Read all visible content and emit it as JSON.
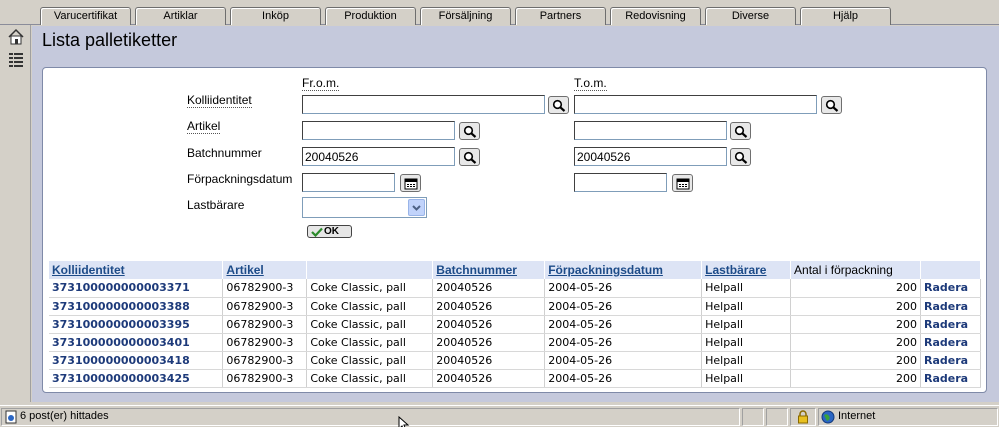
{
  "menu": {
    "tabs": [
      "Varucertifikat",
      "Artiklar",
      "Inköp",
      "Produktion",
      "Försäljning",
      "Partners",
      "Redovisning",
      "Diverse",
      "Hjälp"
    ]
  },
  "page": {
    "title": "Lista palletiketter"
  },
  "form": {
    "from_header": "Fr.o.m.",
    "to_header": "T.o.m.",
    "fields": {
      "kolli_label": "Kolliidentitet",
      "kolli_from": "",
      "kolli_to": "",
      "artikel_label": "Artikel",
      "artikel_from": "",
      "artikel_to": "",
      "batch_label": "Batchnummer",
      "batch_from": "20040526",
      "batch_to": "20040526",
      "forp_label": "Förpackningsdatum",
      "forp_from": "",
      "forp_to": "",
      "last_label": "Lastbärare",
      "last_value": ""
    },
    "ok_label": "OK"
  },
  "table": {
    "headers": [
      "Kolliidentitet",
      "Artikel",
      "",
      "Batchnummer",
      "Förpackningsdatum",
      "Lastbärare",
      "Antal i förpackning",
      ""
    ],
    "rows": [
      [
        "373100000000003371",
        "06782900-3",
        "Coke Classic, pall",
        "20040526",
        "2004-05-26",
        "Helpall",
        "200",
        "Radera"
      ],
      [
        "373100000000003388",
        "06782900-3",
        "Coke Classic, pall",
        "20040526",
        "2004-05-26",
        "Helpall",
        "200",
        "Radera"
      ],
      [
        "373100000000003395",
        "06782900-3",
        "Coke Classic, pall",
        "20040526",
        "2004-05-26",
        "Helpall",
        "200",
        "Radera"
      ],
      [
        "373100000000003401",
        "06782900-3",
        "Coke Classic, pall",
        "20040526",
        "2004-05-26",
        "Helpall",
        "200",
        "Radera"
      ],
      [
        "373100000000003418",
        "06782900-3",
        "Coke Classic, pall",
        "20040526",
        "2004-05-26",
        "Helpall",
        "200",
        "Radera"
      ],
      [
        "373100000000003425",
        "06782900-3",
        "Coke Classic, pall",
        "20040526",
        "2004-05-26",
        "Helpall",
        "200",
        "Radera"
      ]
    ]
  },
  "status": {
    "text": "6 post(er) hittades",
    "zone": "Internet"
  },
  "icons": {
    "home": "home-icon",
    "list": "list-icon",
    "search": "magnifier-icon",
    "calendar": "calendar-icon",
    "lock": "lock-icon",
    "globe": "globe-icon",
    "check": "check-icon"
  }
}
